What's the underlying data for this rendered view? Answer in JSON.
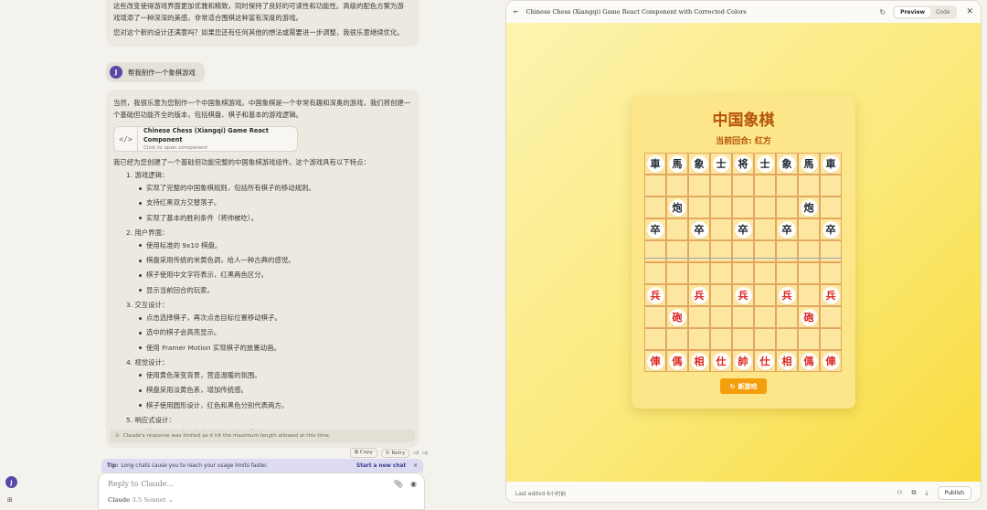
{
  "chat": {
    "prev_tail": [
      "这些改变使得游戏界面更加优雅和精致，同时保持了良好的可读性和功能性。高级的配色方案为游戏增添了一种深深的美感，非常适合围棋这种富有深度的游戏。",
      "您对这个新的设计还满意吗？如果您还有任何其他的想法或需要进一步调整，我很乐意继续优化。"
    ],
    "user_avatar": "J",
    "user_message": "帮我制作一个象棋游戏",
    "ai_intro": "当然，我很乐意为您制作一个中国象棋游戏。中国象棋是一个非常有趣和深奥的游戏，我们将创建一个基础但功能齐全的版本，包括棋盘、棋子和基本的游戏逻辑。",
    "artifact": {
      "icon": "</>",
      "title": "Chinese Chess (Xiangqi) Game React Component",
      "subtitle": "Click to open component"
    },
    "ai_lead": "我已经为您创建了一个基础但功能完整的中国象棋游戏组件。这个游戏具有以下特点：",
    "features": [
      {
        "title": "1. 游戏逻辑：",
        "items": [
          "实现了完整的中国象棋规则，包括所有棋子的移动规则。",
          "支持红黑双方交替落子。",
          "实现了基本的胜利条件（将帅被吃）。"
        ]
      },
      {
        "title": "2. 用户界面：",
        "items": [
          "使用标准的 9x10 棋盘。",
          "棋盘采用传统的米黄色调，给人一种古典的感觉。",
          "棋子使用中文字符表示，红黑两色区分。",
          "显示当前回合的玩家。"
        ]
      },
      {
        "title": "3. 交互设计：",
        "items": [
          "点击选择棋子，再次点击目标位置移动棋子。",
          "选中的棋子会高亮显示。",
          "使用 Framer Motion 实现棋子的放置动画。"
        ]
      },
      {
        "title": "4. 视觉设计：",
        "items": [
          "使用黄色渐变背景，营造温暖的氛围。",
          "棋盘采用淡黄色系，增加传统感。",
          "棋子使用圆形设计，红色和黑色分别代表两方。"
        ]
      },
      {
        "title": "5. 响应式设计：",
        "items": [
          "棋盘大小固定，但整体布局居中，适应不同屏"
        ]
      }
    ],
    "limit_note": "Claude's response was limited as it hit the maximum length allowed at this time.",
    "actions": {
      "copy": "Copy",
      "retry": "Retry"
    },
    "tip": {
      "label": "Tip:",
      "text": "Long chats cause you to reach your usage limits faster.",
      "action": "Start a new chat"
    },
    "composer": {
      "placeholder": "Reply to Claude...",
      "model": "Claude",
      "model_version": "3.5 Sonnet"
    }
  },
  "panel": {
    "title": "Chinese Chess (Xiangqi) Game React Component with Corrected Colors",
    "tab_preview": "Preview",
    "tab_code": "Code",
    "active_tab": "Preview",
    "footer_text": "Last edited 6小时前",
    "publish": "Publish"
  },
  "game": {
    "title": "中国象棋",
    "turn": "当前回合: 红方",
    "new_game": "新游戏",
    "pieces": [
      {
        "r": 0,
        "c": 0,
        "t": "車",
        "s": "black"
      },
      {
        "r": 0,
        "c": 1,
        "t": "馬",
        "s": "black"
      },
      {
        "r": 0,
        "c": 2,
        "t": "象",
        "s": "black"
      },
      {
        "r": 0,
        "c": 3,
        "t": "士",
        "s": "black"
      },
      {
        "r": 0,
        "c": 4,
        "t": "将",
        "s": "black"
      },
      {
        "r": 0,
        "c": 5,
        "t": "士",
        "s": "black"
      },
      {
        "r": 0,
        "c": 6,
        "t": "象",
        "s": "black"
      },
      {
        "r": 0,
        "c": 7,
        "t": "馬",
        "s": "black"
      },
      {
        "r": 0,
        "c": 8,
        "t": "車",
        "s": "black"
      },
      {
        "r": 2,
        "c": 1,
        "t": "炮",
        "s": "black"
      },
      {
        "r": 2,
        "c": 7,
        "t": "炮",
        "s": "black"
      },
      {
        "r": 3,
        "c": 0,
        "t": "卒",
        "s": "black"
      },
      {
        "r": 3,
        "c": 2,
        "t": "卒",
        "s": "black"
      },
      {
        "r": 3,
        "c": 4,
        "t": "卒",
        "s": "black"
      },
      {
        "r": 3,
        "c": 6,
        "t": "卒",
        "s": "black"
      },
      {
        "r": 3,
        "c": 8,
        "t": "卒",
        "s": "black"
      },
      {
        "r": 6,
        "c": 0,
        "t": "兵",
        "s": "red"
      },
      {
        "r": 6,
        "c": 2,
        "t": "兵",
        "s": "red"
      },
      {
        "r": 6,
        "c": 4,
        "t": "兵",
        "s": "red"
      },
      {
        "r": 6,
        "c": 6,
        "t": "兵",
        "s": "red"
      },
      {
        "r": 6,
        "c": 8,
        "t": "兵",
        "s": "red"
      },
      {
        "r": 7,
        "c": 1,
        "t": "砲",
        "s": "red"
      },
      {
        "r": 7,
        "c": 7,
        "t": "砲",
        "s": "red"
      },
      {
        "r": 9,
        "c": 0,
        "t": "俥",
        "s": "red"
      },
      {
        "r": 9,
        "c": 1,
        "t": "傌",
        "s": "red"
      },
      {
        "r": 9,
        "c": 2,
        "t": "相",
        "s": "red"
      },
      {
        "r": 9,
        "c": 3,
        "t": "仕",
        "s": "red"
      },
      {
        "r": 9,
        "c": 4,
        "t": "帥",
        "s": "red"
      },
      {
        "r": 9,
        "c": 5,
        "t": "仕",
        "s": "red"
      },
      {
        "r": 9,
        "c": 6,
        "t": "相",
        "s": "red"
      },
      {
        "r": 9,
        "c": 7,
        "t": "傌",
        "s": "red"
      },
      {
        "r": 9,
        "c": 8,
        "t": "俥",
        "s": "red"
      }
    ],
    "colors": {
      "red": "#dc2626",
      "black": "#1f2937",
      "button": "#f59e0b",
      "title": "#b45309"
    }
  }
}
